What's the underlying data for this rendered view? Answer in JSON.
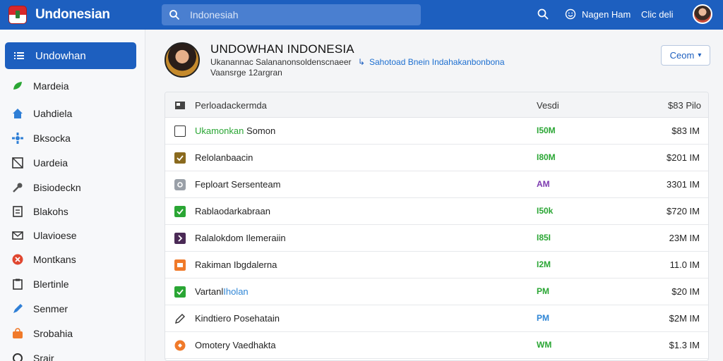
{
  "topbar": {
    "brand": "Undonesian",
    "search_placeholder": "Indonesiah",
    "user_link": "Nagen Ham",
    "lang_link": "Clic deli"
  },
  "sidebar": {
    "active": "Undowhan",
    "items": [
      "Mardeia",
      "Uahdiela",
      "Bksocka",
      "Uardeia",
      "Bisiodeckn",
      "Blakohs",
      "Ulavioese",
      "Montkans",
      "Blertinle",
      "Senmer",
      "Srobahia",
      "Srair"
    ]
  },
  "profile": {
    "title": "UNDOWHAN INDONESIA",
    "subtitle": "Ukanannac Salananonsoldenscnaeer",
    "arrow": "↳",
    "link": "Sahotoad Bnein Indahakanbonbona",
    "meta": "Vaansrge 12argran"
  },
  "zoom_button": {
    "label": "Ceom",
    "icon": "chevron-down-icon"
  },
  "table": {
    "header": {
      "name": "Perloadackermda",
      "value": "Vesdi",
      "size": "$83 Pilo"
    },
    "rows": [
      {
        "name_a": "Ukamonkan",
        "name_b": " Somon",
        "value": "I50M",
        "value_color": "green",
        "size": "$83 IM",
        "icon": "checkbox-icon",
        "icon_color": "#ffffff"
      },
      {
        "name_a": "",
        "name_b": "Relolanbaacin",
        "value": "I80M",
        "value_color": "green",
        "size": "$201 IM",
        "icon": "check-square-icon",
        "icon_color": "#8a6a1e"
      },
      {
        "name_a": "",
        "name_b": "Feploart Sersenteam",
        "value": "AM",
        "value_color": "purple",
        "size": "3301 IM",
        "icon": "settings-square-icon",
        "icon_color": "#9aa0a8"
      },
      {
        "name_a": "",
        "name_b": "Rablaodarkabraan",
        "value": "I50k",
        "value_color": "green",
        "size": "$720 IM",
        "icon": "check-square-icon",
        "icon_color": "#2aa634"
      },
      {
        "name_a": "",
        "name_b": "Ralalokdom Ilemeraiin",
        "value": "I85I",
        "value_color": "green",
        "size": "23M IM",
        "icon": "chevron-square-icon",
        "icon_color": "#4b2a56"
      },
      {
        "name_a": "",
        "name_b": "Rakiman Ibgdalerna",
        "value": "I2M",
        "value_color": "green",
        "size": "11.0 IM",
        "icon": "image-square-icon",
        "icon_color": "#f07a2a"
      },
      {
        "name_a": "Vartanl",
        "name_b": "Iholan",
        "value": "PM",
        "value_color": "green",
        "size": "$20 IM",
        "icon": "check-square-icon",
        "icon_color": "#2aa634"
      },
      {
        "name_a": "",
        "name_b": "Kindtiero Posehatain",
        "value": "PM",
        "value_color": "blue",
        "size": "$2M IM",
        "icon": "pencil-icon",
        "icon_color": "#333333"
      },
      {
        "name_a": "",
        "name_b": "Omotery Vaedhakta",
        "value": "WM",
        "value_color": "green",
        "size": "$1.3 IM",
        "icon": "orange-circle-icon",
        "icon_color": "#f07a2a"
      }
    ]
  }
}
